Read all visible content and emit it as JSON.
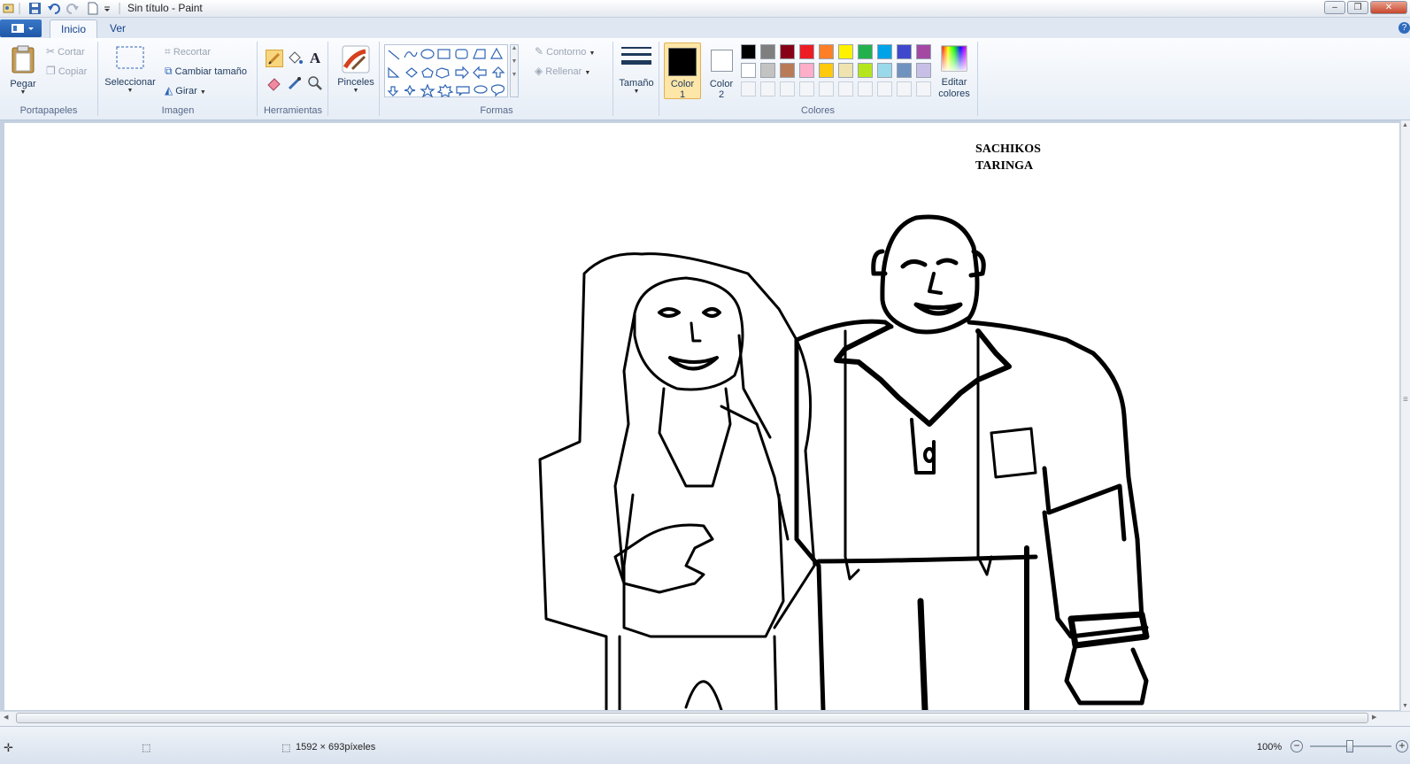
{
  "window": {
    "title": "Sin título - Paint"
  },
  "tabs": [
    {
      "label": "Inicio"
    },
    {
      "label": "Ver"
    }
  ],
  "clipboard": {
    "paste_label": "Pegar",
    "cut_label": "Cortar",
    "copy_label": "Copiar",
    "group_label": "Portapapeles"
  },
  "image": {
    "select_label": "Seleccionar",
    "crop_label": "Recortar",
    "resize_label": "Cambiar tamaño",
    "rotate_label": "Girar",
    "group_label": "Imagen"
  },
  "tools": {
    "group_label": "Herramientas",
    "brushes_label": "Pinceles"
  },
  "shapes": {
    "outline_label": "Contorno",
    "fill_label": "Rellenar",
    "group_label": "Formas"
  },
  "size": {
    "label": "Tamaño"
  },
  "colors": {
    "color1_label": "Color",
    "color1_num": "1",
    "color2_label": "Color",
    "color2_num": "2",
    "edit_label": "Editar",
    "edit_label2": "colores",
    "group_label": "Colores",
    "palette_row1": [
      "#000000",
      "#7f7f7f",
      "#880015",
      "#ed1c24",
      "#ff7f27",
      "#fff200",
      "#22b14c",
      "#00a2e8",
      "#3f48cc",
      "#a349a4"
    ],
    "palette_row2": [
      "#ffffff",
      "#c3c3c3",
      "#b97a57",
      "#ffaec9",
      "#ffc90e",
      "#efe4b0",
      "#b5e61d",
      "#99d9ea",
      "#7092be",
      "#c8bfe7"
    ],
    "color1_value": "#000000",
    "color2_value": "#ffffff",
    "accent": "#f5c15e"
  },
  "canvas": {
    "text_line1": "SACHIKOS",
    "text_line2": "TARINGA"
  },
  "status": {
    "dimensions": "1592 × 693píxeles",
    "zoom": "100%"
  }
}
